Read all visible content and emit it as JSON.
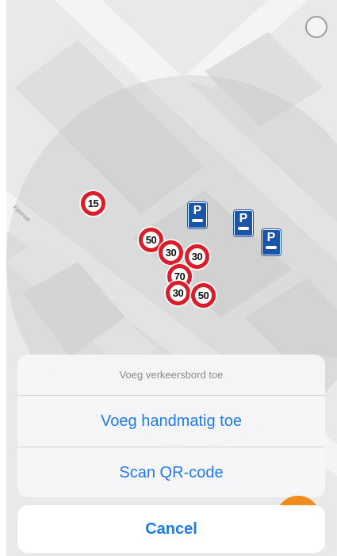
{
  "map": {
    "street_name": "Fijlstraat",
    "speed_signs": [
      "15",
      "50",
      "30",
      "30",
      "70",
      "30",
      "50"
    ],
    "parking_sign_label": "P"
  },
  "icons": {
    "profile": "profile-icon",
    "speed_sign": "speed-limit-sign-icon",
    "parking_sign": "parking-sign-icon"
  },
  "action_sheet": {
    "title": "Voeg verkeersbord toe",
    "manual_label": "Voeg handmatig toe",
    "scan_label": "Scan QR-code",
    "cancel_label": "Cancel"
  },
  "colors": {
    "accent": "#1f7aed",
    "speed_ring": "#d81e2a",
    "parking": "#1c55a8",
    "fab": "#f08c1a"
  }
}
